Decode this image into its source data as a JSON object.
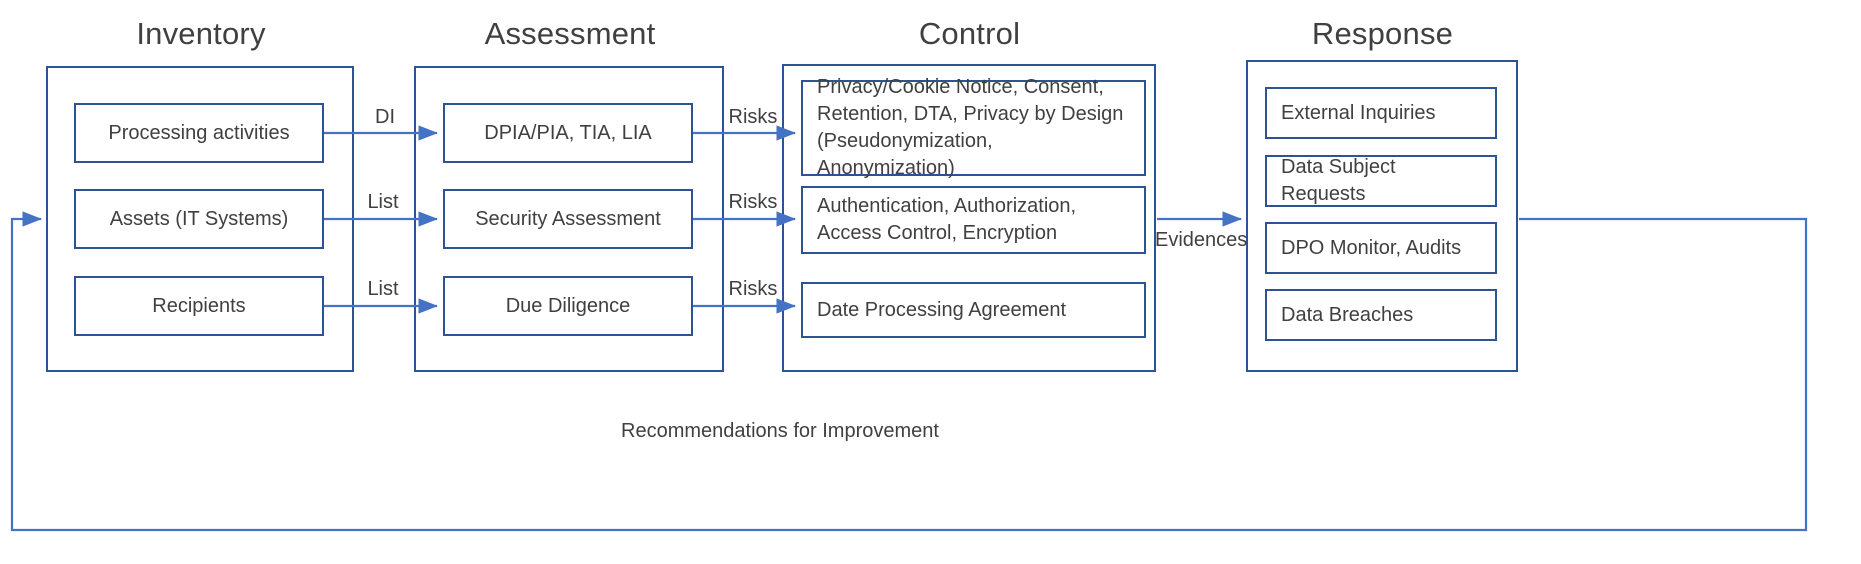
{
  "diagram": {
    "title_row": [
      {
        "label": "Inventory"
      },
      {
        "label": "Assessment"
      },
      {
        "label": "Control"
      },
      {
        "label": "Response"
      }
    ],
    "columns": {
      "inventory": {
        "header": "Inventory",
        "items": [
          {
            "label": "Processing activities"
          },
          {
            "label": "Assets (IT Systems)"
          },
          {
            "label": "Recipients"
          }
        ]
      },
      "assessment": {
        "header": "Assessment",
        "items": [
          {
            "label": "DPIA/PIA, TIA, LIA"
          },
          {
            "label": "Security Assessment"
          },
          {
            "label": "Due Diligence"
          }
        ]
      },
      "control": {
        "header": "Control",
        "items": [
          {
            "label": "Privacy/Cookie Notice, Consent, Retention, DTA, Privacy by Design (Pseudonymization, Anonymization)"
          },
          {
            "label": "Authentication, Authorization, Access Control, Encryption"
          },
          {
            "label": "Date Processing Agreement"
          }
        ]
      },
      "response": {
        "header": "Response",
        "items": [
          {
            "label": "External Inquiries"
          },
          {
            "label": "Data Subject Requests"
          },
          {
            "label": "DPO Monitor, Audits"
          },
          {
            "label": "Data Breaches"
          }
        ]
      }
    },
    "edge_labels": {
      "inventory_to_assessment": [
        {
          "label": "DI"
        },
        {
          "label": "List"
        },
        {
          "label": "List"
        }
      ],
      "assessment_to_control": [
        {
          "label": "Risks"
        },
        {
          "label": "Risks"
        },
        {
          "label": "Risks"
        }
      ],
      "control_to_response": {
        "label": "Evidences"
      },
      "feedback_loop": {
        "label": "Recommendations for Improvement"
      }
    },
    "colors": {
      "box_border": "#2E5395",
      "arrow": "#4472C4",
      "text": "#404040",
      "background": "#FFFFFF"
    }
  }
}
